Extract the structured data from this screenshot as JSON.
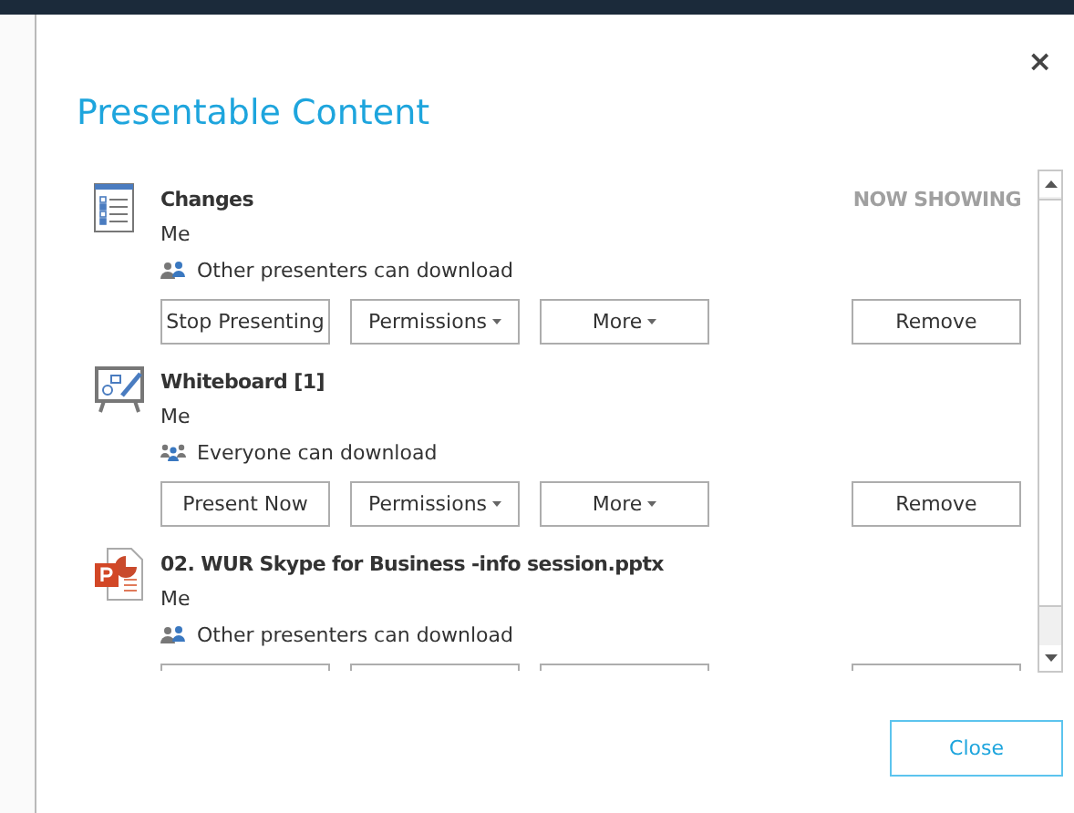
{
  "dialog": {
    "title": "Presentable Content",
    "close_glyph": "×"
  },
  "items": [
    {
      "kind": "list",
      "title": "Changes",
      "owner": "Me",
      "permission": {
        "kind": "presenters",
        "text": "Other presenters can download"
      },
      "status": "NOW SHOWING",
      "buttons": [
        {
          "label": "Stop Presenting",
          "dropdown": false
        },
        {
          "label": "Permissions",
          "dropdown": true
        },
        {
          "label": "More",
          "dropdown": true
        }
      ],
      "remove": "Remove",
      "buttons_clipped": false
    },
    {
      "kind": "whiteboard",
      "title": "Whiteboard [1]",
      "owner": "Me",
      "permission": {
        "kind": "everyone",
        "text": "Everyone can download"
      },
      "buttons": [
        {
          "label": "Present Now",
          "dropdown": false
        },
        {
          "label": "Permissions",
          "dropdown": true
        },
        {
          "label": "More",
          "dropdown": true
        }
      ],
      "remove": "Remove",
      "buttons_clipped": false
    },
    {
      "kind": "powerpoint",
      "title": "02. WUR Skype for Business -info session.pptx",
      "owner": "Me",
      "permission": {
        "kind": "presenters",
        "text": "Other presenters can download"
      },
      "buttons_clipped": true
    }
  ],
  "footer": {
    "close": "Close"
  }
}
